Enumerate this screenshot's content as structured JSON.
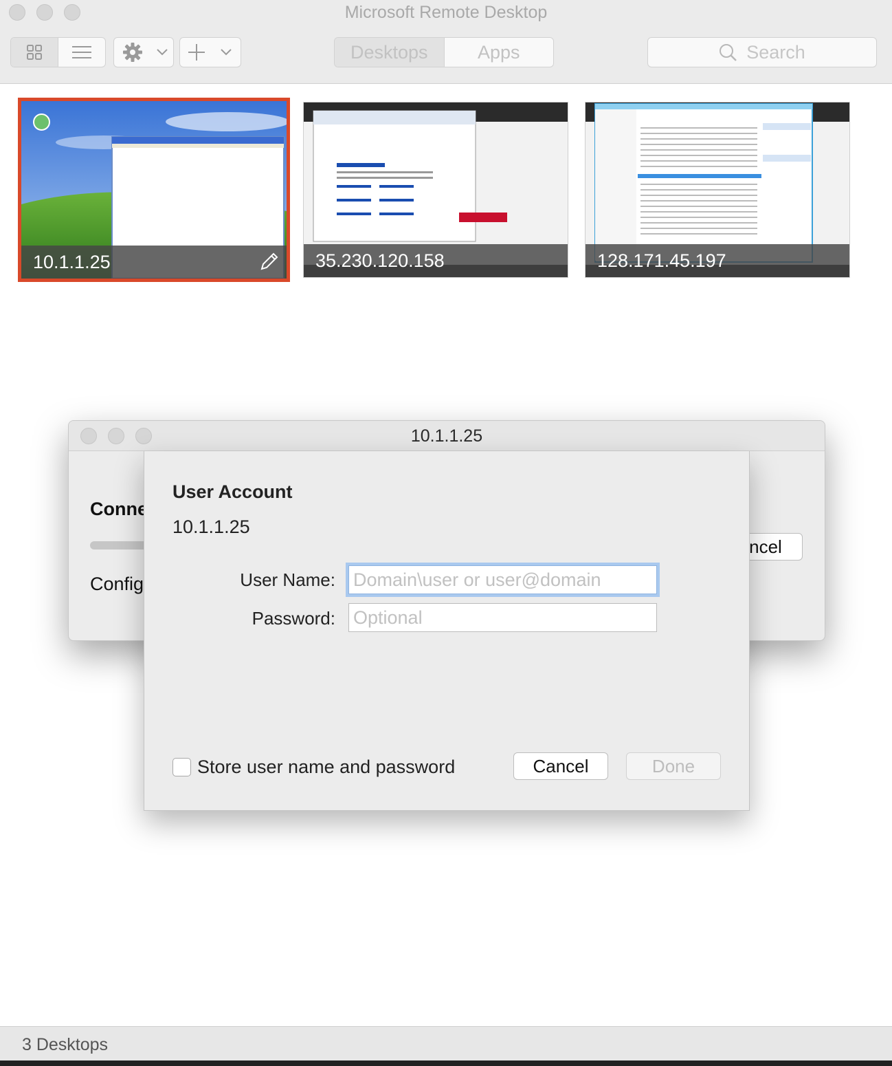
{
  "window": {
    "title": "Microsoft Remote Desktop"
  },
  "toolbar": {
    "tabs": [
      {
        "label": "Desktops",
        "active": true
      },
      {
        "label": "Apps",
        "active": false
      }
    ],
    "search_placeholder": "Search"
  },
  "desktops": [
    {
      "host": "10.1.1.25",
      "selected": true,
      "connected": true
    },
    {
      "host": "35.230.120.158",
      "selected": false,
      "connected": false
    },
    {
      "host": "128.171.45.197",
      "selected": false,
      "connected": false
    }
  ],
  "connecting_window": {
    "title": "10.1.1.25",
    "heading": "Conne",
    "status": "Config",
    "cancel_label": "ncel"
  },
  "user_account_sheet": {
    "heading": "User Account",
    "host": "10.1.1.25",
    "username_label": "User Name:",
    "username_placeholder": "Domain\\user or user@domain",
    "username_value": "",
    "password_label": "Password:",
    "password_placeholder": "Optional",
    "password_value": "",
    "store_checkbox_label": "Store user name and password",
    "store_checked": false,
    "cancel_label": "Cancel",
    "done_label": "Done"
  },
  "statusbar": {
    "text": "3 Desktops"
  },
  "colors": {
    "selection_border": "#d9492a",
    "connected_dot": "#6cc06c",
    "focus_ring": "#a9c9ef"
  }
}
